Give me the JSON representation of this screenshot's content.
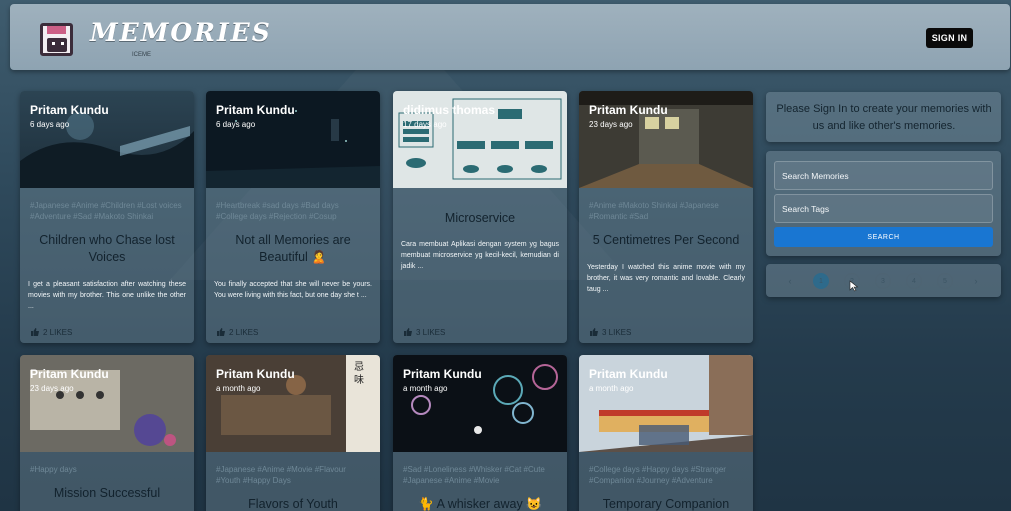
{
  "header": {
    "brand": "MEMORIES",
    "brand_sub": "ICEME",
    "signin_label": "SIGN IN"
  },
  "cards": [
    {
      "author": "Pritam Kundu",
      "time": "6 days ago",
      "tags": "#Japanese #Anime #Children #Lost voices #Adventure #Sad #Makoto Shinkai",
      "title": "Children who Chase lost Voices",
      "message": "I get a pleasant satisfaction after watching these movies with my brother. This one unlike the other ...",
      "likes": "2 LIKES"
    },
    {
      "author": "Pritam Kundu",
      "time": "6 days ago",
      "tags": "#Heartbreak #sad days #Bad days #College days #Rejection #Cosup",
      "title": "Not all Memories are Beautiful 🙎",
      "message": "You finally accepted that she will never be yours. You were living with this fact, but one day she t ...",
      "likes": "2 LIKES"
    },
    {
      "author": "didimus thomas",
      "time": "17 days ago",
      "tags": "",
      "title": "Microservice",
      "message": "Cara membuat Aplikasi dengan system yg bagus membuat microservice yg kecil-kecil, kemudian di jadik ...",
      "likes": "3 LIKES"
    },
    {
      "author": "Pritam Kundu",
      "time": "23 days ago",
      "tags": "#Anime #Makoto Shinkai #Japanese #Romantic #Sad",
      "title": "5 Centimetres Per Second",
      "message": "Yesterday I watched this anime movie with my brother, it was very romantic and lovable. Clearly taug ...",
      "likes": "3 LIKES"
    },
    {
      "author": "Pritam Kundu",
      "time": "23 days ago",
      "tags": "#Happy days",
      "title": "Mission Successful",
      "message": "",
      "likes": ""
    },
    {
      "author": "Pritam Kundu",
      "time": "a month ago",
      "tags": "#Japanese #Anime #Movie #Flavour #Youth #Happy Days",
      "title": "Flavors of Youth",
      "message": "",
      "likes": ""
    },
    {
      "author": "Pritam Kundu",
      "time": "a month ago",
      "tags": "#Sad #Loneliness #Whisker #Cat #Cute #Japanese #Anime #Movie",
      "title": "🐈 A whisker away 😺",
      "message": "",
      "likes": ""
    },
    {
      "author": "Pritam Kundu",
      "time": "a month ago",
      "tags": "#College days #Happy days #Stranger #Companion #Journey #Adventure",
      "title": "Temporary Companion",
      "message": "",
      "likes": ""
    }
  ],
  "sidebar": {
    "notice": "Please Sign In to create your memories with us and like other's memories.",
    "search_memories": "Search Memories",
    "search_tags": "Search Tags",
    "search_button": "SEARCH",
    "pagination": [
      "‹",
      "1",
      "2",
      "3",
      "4",
      "5",
      "›"
    ]
  },
  "colors": {
    "accent": "#1976d2",
    "appbar": "#9fb1bd",
    "background": "#2f4a5c"
  }
}
